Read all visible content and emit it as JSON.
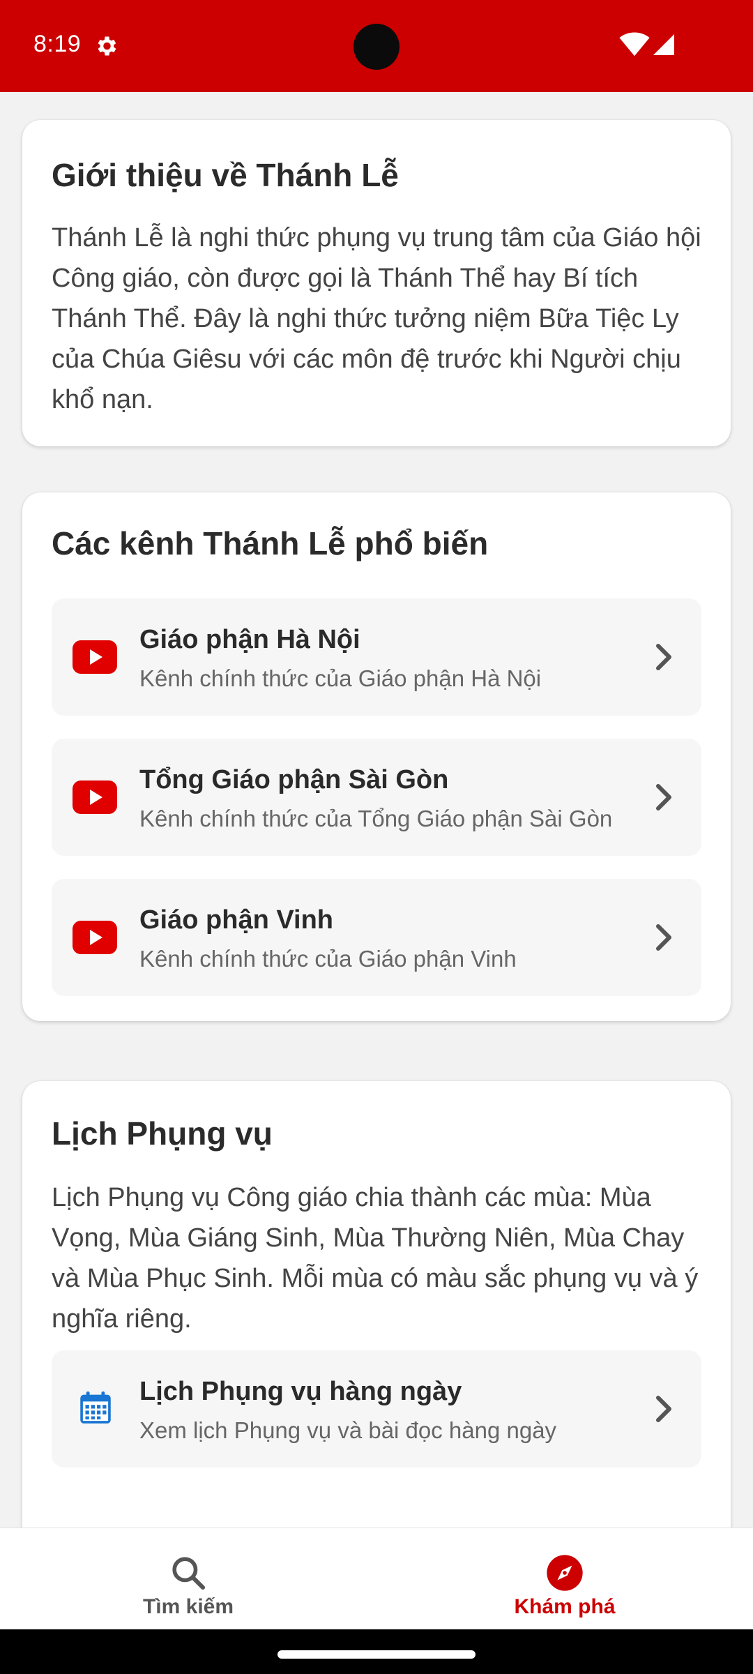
{
  "status_bar": {
    "time": "8:19",
    "icons": [
      "settings-icon",
      "wifi-icon",
      "cellular-signal-icon"
    ]
  },
  "intro_card": {
    "title": "Giới thiệu về Thánh Lễ",
    "text": "Thánh Lễ là nghi thức phụng vụ trung tâm của Giáo hội Công giáo, còn được gọi là Thánh Thể hay Bí tích Thánh Thể. Đây là nghi thức tưởng niệm Bữa Tiệc Ly của Chúa Giêsu với các môn đệ trước khi Người chịu khổ nạn."
  },
  "channels_card": {
    "title": "Các kênh Thánh Lễ phổ biến",
    "items": [
      {
        "title": "Giáo phận Hà Nội",
        "subtitle": "Kênh chính thức của Giáo phận Hà Nội",
        "icon": "youtube-icon"
      },
      {
        "title": "Tổng Giáo phận Sài Gòn",
        "subtitle": "Kênh chính thức của Tổng Giáo phận Sài Gòn",
        "icon": "youtube-icon"
      },
      {
        "title": "Giáo phận Vinh",
        "subtitle": "Kênh chính thức của Giáo phận Vinh",
        "icon": "youtube-icon"
      }
    ]
  },
  "liturgy_card": {
    "title": "Lịch Phụng vụ",
    "text": "Lịch Phụng vụ Công giáo chia thành các mùa: Mùa Vọng, Mùa Giáng Sinh, Mùa Thường Niên, Mùa Chay và Mùa Phục Sinh. Mỗi mùa có màu sắc phụng vụ và ý nghĩa riêng.",
    "item": {
      "title": "Lịch Phụng vụ hàng ngày",
      "subtitle": "Xem lịch Phụng vụ và bài đọc hàng ngày",
      "icon": "calendar-icon"
    }
  },
  "bottom_nav": {
    "items": [
      {
        "label": "Tìm kiếm",
        "icon": "search-icon",
        "active": false
      },
      {
        "label": "Khám phá",
        "icon": "compass-icon",
        "active": true
      }
    ]
  },
  "colors": {
    "brand": "#cc0000",
    "youtube": "#e00000",
    "calendar": "#1976d2"
  }
}
